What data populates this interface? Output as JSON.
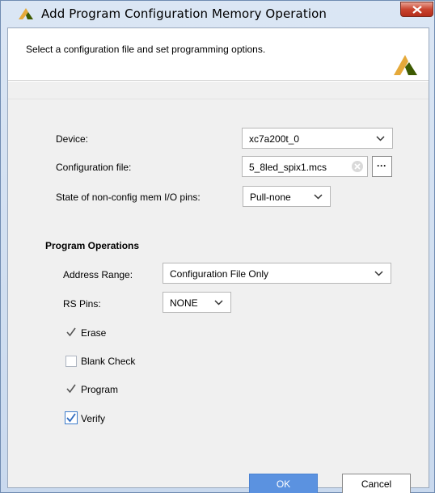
{
  "window": {
    "title": "Add Program Configuration Memory Operation"
  },
  "header": {
    "instructions": "Select a configuration file and set programming options."
  },
  "form": {
    "device": {
      "label": "Device:",
      "value": "xc7a200t_0"
    },
    "config_file": {
      "label": "Configuration file:",
      "value": "5_8led_spix1.mcs",
      "browse_label": "···"
    },
    "io_pins": {
      "label": "State of non-config mem I/O pins:",
      "value": "Pull-none"
    }
  },
  "program_operations": {
    "title": "Program Operations",
    "address_range": {
      "label": "Address Range:",
      "value": "Configuration File Only"
    },
    "rs_pins": {
      "label": "RS Pins:",
      "value": "NONE"
    },
    "checks": [
      {
        "label": "Erase",
        "checked": true
      },
      {
        "label": "Blank Check",
        "checked": false
      },
      {
        "label": "Program",
        "checked": true
      },
      {
        "label": "Verify",
        "checked": true
      }
    ]
  },
  "buttons": {
    "ok": "OK",
    "cancel": "Cancel"
  },
  "colors": {
    "accent": "#5b92e0",
    "logo": "#e5a93a",
    "logo_dark": "#3d5a00"
  }
}
